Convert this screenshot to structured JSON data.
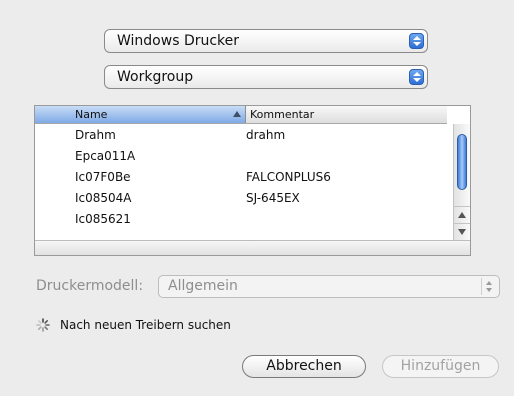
{
  "printer_type_popup": {
    "value": "Windows Drucker"
  },
  "workgroup_popup": {
    "value": "Workgroup"
  },
  "printer_list": {
    "columns": {
      "name": "Name",
      "comment": "Kommentar"
    },
    "rows": [
      {
        "name": "Drahm",
        "comment": "drahm"
      },
      {
        "name": "Epca011A",
        "comment": ""
      },
      {
        "name": "Ic07F0Be",
        "comment": "FALCONPLUS6"
      },
      {
        "name": "Ic08504A",
        "comment": "SJ-645EX"
      },
      {
        "name": "Ic085621",
        "comment": ""
      }
    ]
  },
  "model": {
    "label": "Druckermodell:",
    "value": "Allgemein"
  },
  "status": {
    "text": "Nach neuen Treibern suchen"
  },
  "buttons": {
    "cancel": "Abbrechen",
    "add": "Hinzufügen"
  }
}
